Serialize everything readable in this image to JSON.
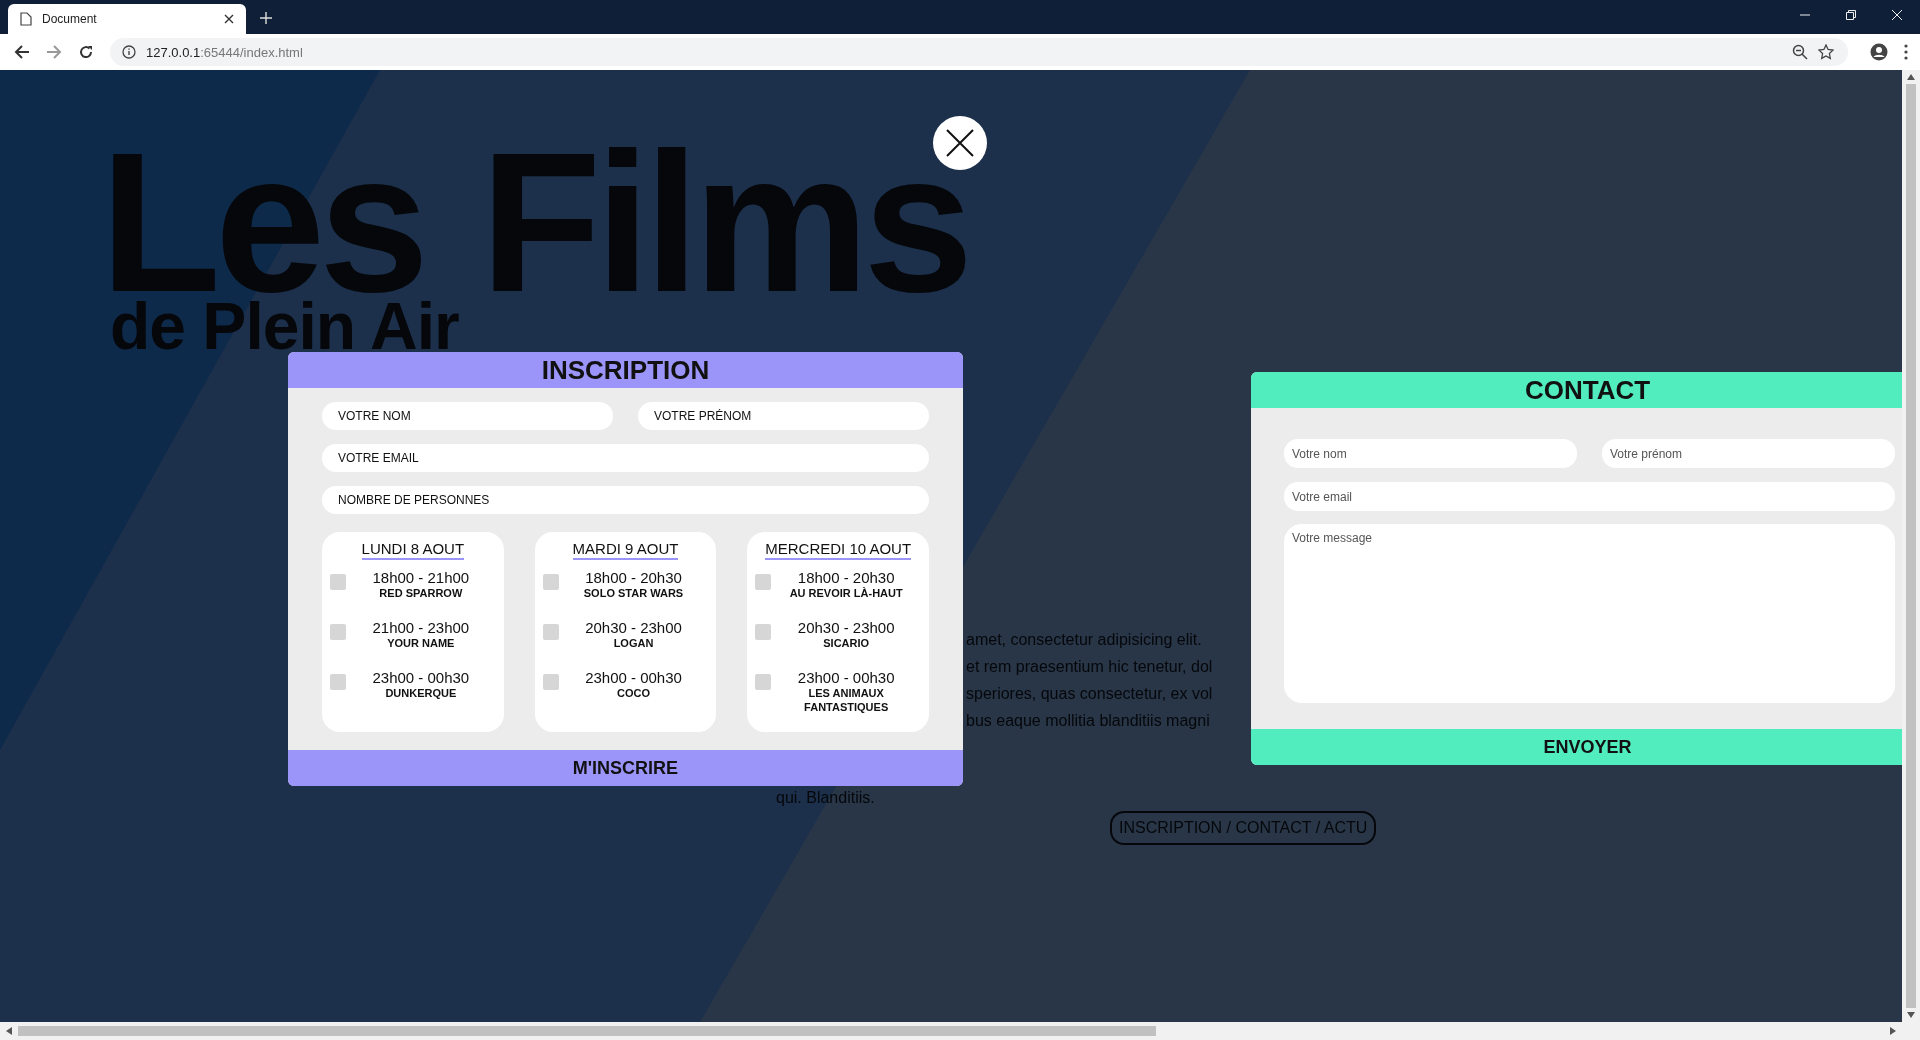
{
  "browser": {
    "tab_title": "Document",
    "url_host": "127.0.0.1",
    "url_path": ":65444/index.html"
  },
  "page": {
    "title": "Les Films",
    "subtitle": "de Plein Air",
    "paragraph_lines": [
      "amet, consectetur adipisicing elit.",
      "et rem praesentium hic tenetur, dol",
      "speriores, quas consectetur, ex vol",
      "bus eaque mollitia blanditiis magni",
      "qui. Blanditiis."
    ],
    "nav_button": "INSCRIPTION / CONTACT / ACTU"
  },
  "inscription": {
    "title": "INSCRIPTION",
    "fields": [
      {
        "placeholder": "VOTRE NOM"
      },
      {
        "placeholder": "VOTRE PRÉNOM"
      },
      {
        "placeholder": "VOTRE EMAIL"
      },
      {
        "placeholder": "NOMBRE DE PERSONNES"
      }
    ],
    "days": [
      {
        "title": "LUNDI 8 AOUT",
        "sessions": [
          {
            "time": "18h00 - 21h00",
            "film": "RED SPARROW",
            "checked": false
          },
          {
            "time": "21h00 - 23h00",
            "film": "YOUR NAME",
            "checked": false
          },
          {
            "time": "23h00 - 00h30",
            "film": "DUNKERQUE",
            "checked": false
          }
        ]
      },
      {
        "title": "MARDI 9 AOUT",
        "sessions": [
          {
            "time": "18h00 - 20h30",
            "film": "SOLO STAR WARS",
            "checked": false
          },
          {
            "time": "20h30 - 23h00",
            "film": "LOGAN",
            "checked": false
          },
          {
            "time": "23h00 - 00h30",
            "film": "COCO",
            "checked": false
          }
        ]
      },
      {
        "title": "MERCREDI 10 AOUT",
        "sessions": [
          {
            "time": "18h00 - 20h30",
            "film": "AU REVOIR LÀ-HAUT",
            "checked": false
          },
          {
            "time": "20h30 - 23h00",
            "film": "SICARIO",
            "checked": false
          },
          {
            "time": "23h00 - 00h30",
            "film": "LES ANIMAUX FANTASTIQUES",
            "checked": false
          }
        ]
      }
    ],
    "submit": "M'INSCRIRE"
  },
  "contact": {
    "title": "CONTACT",
    "fields": [
      {
        "placeholder": "Votre nom"
      },
      {
        "placeholder": "Votre prénom"
      },
      {
        "placeholder": "Votre email"
      }
    ],
    "message_placeholder": "Votre message",
    "submit": "ENVOYER"
  }
}
